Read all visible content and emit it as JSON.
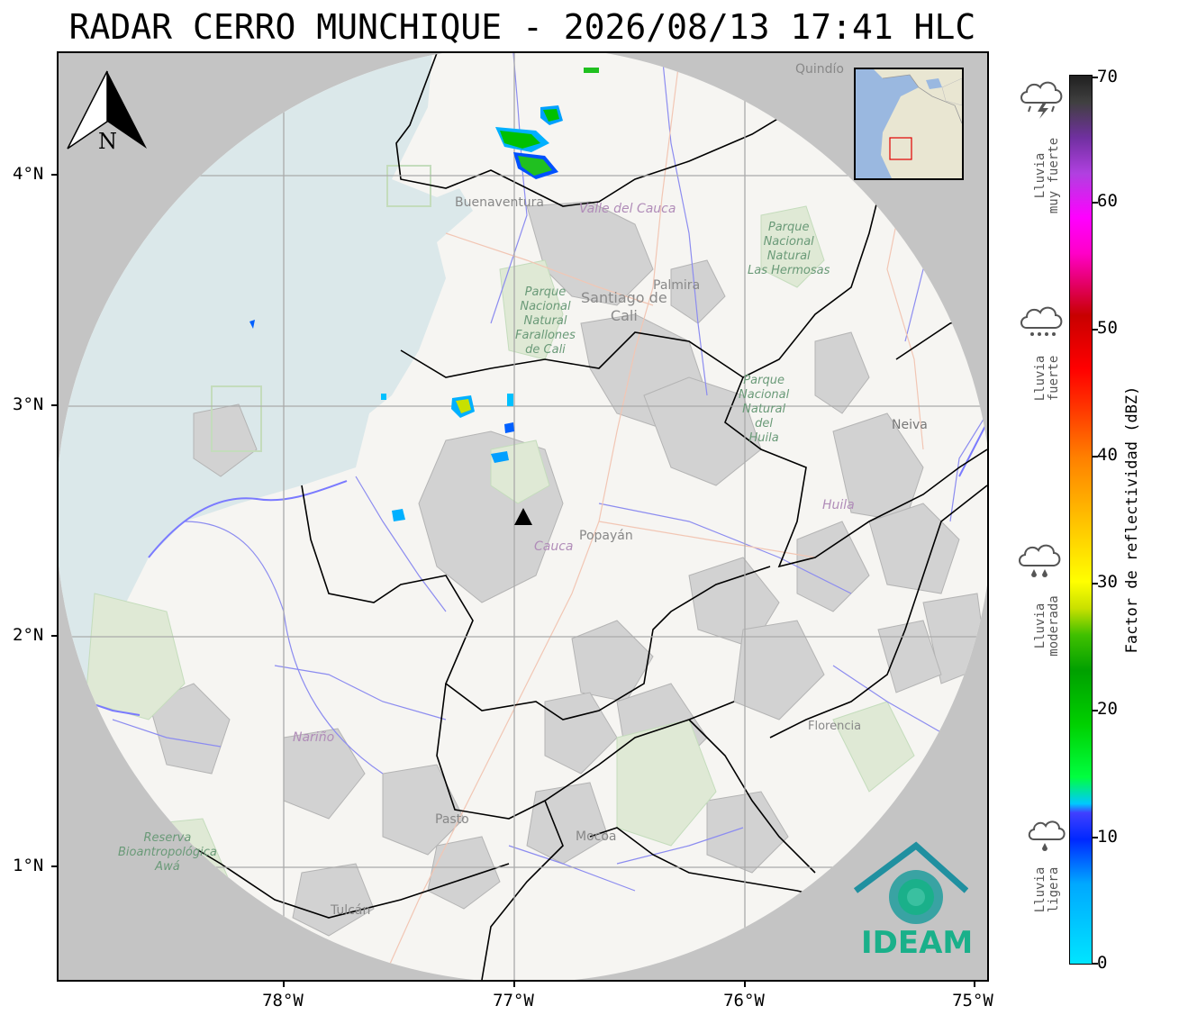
{
  "title": "RADAR CERRO MUNCHIQUE - 2026/08/13 17:41 HLC",
  "axes": {
    "y_ticks": [
      "4°N",
      "3°N",
      "2°N",
      "1°N"
    ],
    "x_ticks": [
      "78°W",
      "77°W",
      "76°W",
      "75°W"
    ]
  },
  "north_arrow": {
    "label": "N"
  },
  "colorbar": {
    "label": "Factor de reflectividad (dBZ)",
    "ticks": [
      "70",
      "60",
      "50",
      "40",
      "30",
      "20",
      "10",
      "0"
    ],
    "min": 0,
    "max": 70
  },
  "rain_categories": [
    {
      "line1": "Lluvia",
      "line2": "muy fuerte",
      "icon": "cloud-thunder-icon"
    },
    {
      "line1": "Lluvia",
      "line2": "fuerte",
      "icon": "cloud-heavy-rain-icon"
    },
    {
      "line1": "Lluvia",
      "line2": "moderada",
      "icon": "cloud-rain-icon"
    },
    {
      "line1": "Lluvia",
      "line2": "ligera",
      "icon": "cloud-drizzle-icon"
    }
  ],
  "logo": {
    "text": "IDEAM",
    "color": "#1ab08a"
  },
  "map_labels": {
    "quindio": "Quindío",
    "buenaventura": "Buenaventura",
    "valle": "Valle del Cauca",
    "palmira": "Palmira",
    "cali_1": "Santiago de",
    "cali_2": "Cali",
    "farallones": [
      "Parque",
      "Nacional",
      "Natural",
      "Farallones",
      "de Cali"
    ],
    "hermosas": [
      "Parque",
      "Nacional",
      "Natural",
      "Las Hermosas"
    ],
    "nevado": [
      "Parque",
      "Nacional",
      "Natural",
      "del",
      "Huila"
    ],
    "neiva": "Neiva",
    "huila": "Huila",
    "cauca": "Cauca",
    "popayan": "Popayán",
    "narino": "Nariño",
    "florencia": "Florencia",
    "pasto": "Pasto",
    "mocoa": "Mocoa",
    "tulcan": "Tulcán",
    "awa": [
      "Reserva",
      "Bioantropológica",
      "Awá"
    ]
  },
  "colors": {
    "ocean": "#dbe8ea",
    "land": "#f6f5f2",
    "outside": "#c4c4c4",
    "radar_site": "#000000"
  }
}
